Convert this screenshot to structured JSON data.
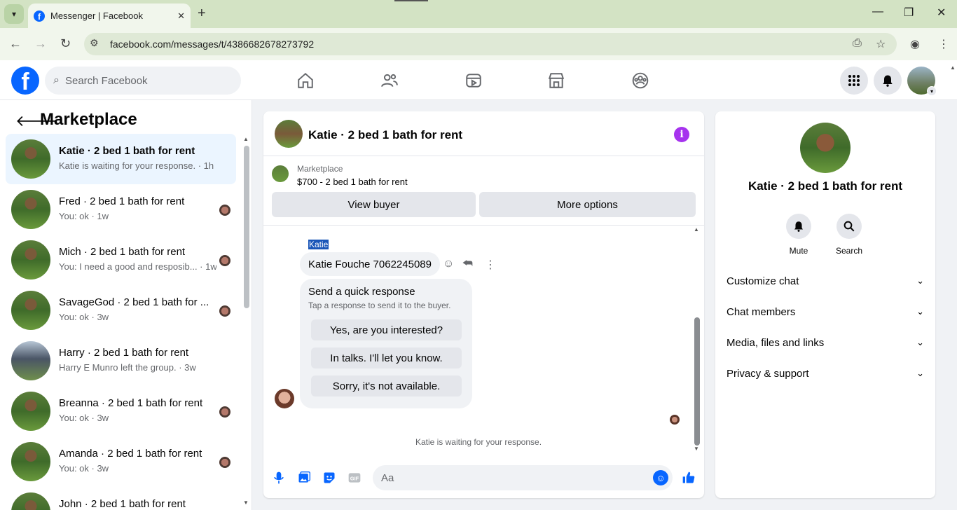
{
  "browser": {
    "tab_title": "Messenger | Facebook",
    "url": "facebook.com/messages/t/4386682678273792"
  },
  "header": {
    "search_placeholder": "Search Facebook"
  },
  "sidebar": {
    "title": "Marketplace",
    "conversations": [
      {
        "name": "Katie · 2 bed 1 bath for rent",
        "preview": "Katie is waiting for your response. · 1h"
      },
      {
        "name": "Fred · 2 bed 1 bath for rent",
        "preview": "You: ok · 1w"
      },
      {
        "name": "Mich · 2 bed 1 bath for rent",
        "preview": "You: I need a good and resposib... · 1w"
      },
      {
        "name": "SavageGod · 2 bed 1 bath for ...",
        "preview": "You: ok · 3w"
      },
      {
        "name": "Harry · 2 bed 1 bath for rent",
        "preview": "Harry E Munro left the group. · 3w"
      },
      {
        "name": "Breanna · 2 bed 1 bath for rent",
        "preview": "You: ok · 3w"
      },
      {
        "name": "Amanda · 2 bed 1 bath for rent",
        "preview": "You: ok · 3w"
      },
      {
        "name": "John · 2 bed 1 bath for rent",
        "preview": ""
      }
    ]
  },
  "chat": {
    "title": "Katie · 2 bed 1 bath for rent",
    "marketplace_label": "Marketplace",
    "listing": "$700 - 2 bed 1 bath for rent",
    "view_buyer": "View buyer",
    "more_options": "More options",
    "sender_name": "Katie",
    "message": "Katie Fouche 7062245089",
    "quick_title": "Send a quick response",
    "quick_sub": "Tap a response to send it to the buyer.",
    "quick_replies": [
      "Yes, are you interested?",
      "In talks. I'll let you know.",
      "Sorry, it's not available."
    ],
    "waiting": "Katie is waiting for your response.",
    "composer_placeholder": "Aa"
  },
  "details": {
    "name": "Katie · 2 bed 1 bath for rent",
    "mute": "Mute",
    "search": "Search",
    "sections": [
      "Customize chat",
      "Chat members",
      "Media, files and links",
      "Privacy & support"
    ]
  },
  "colors": {
    "brand": "#0866ff",
    "info": "#a633ee",
    "active_conv": "#ebf5ff"
  }
}
